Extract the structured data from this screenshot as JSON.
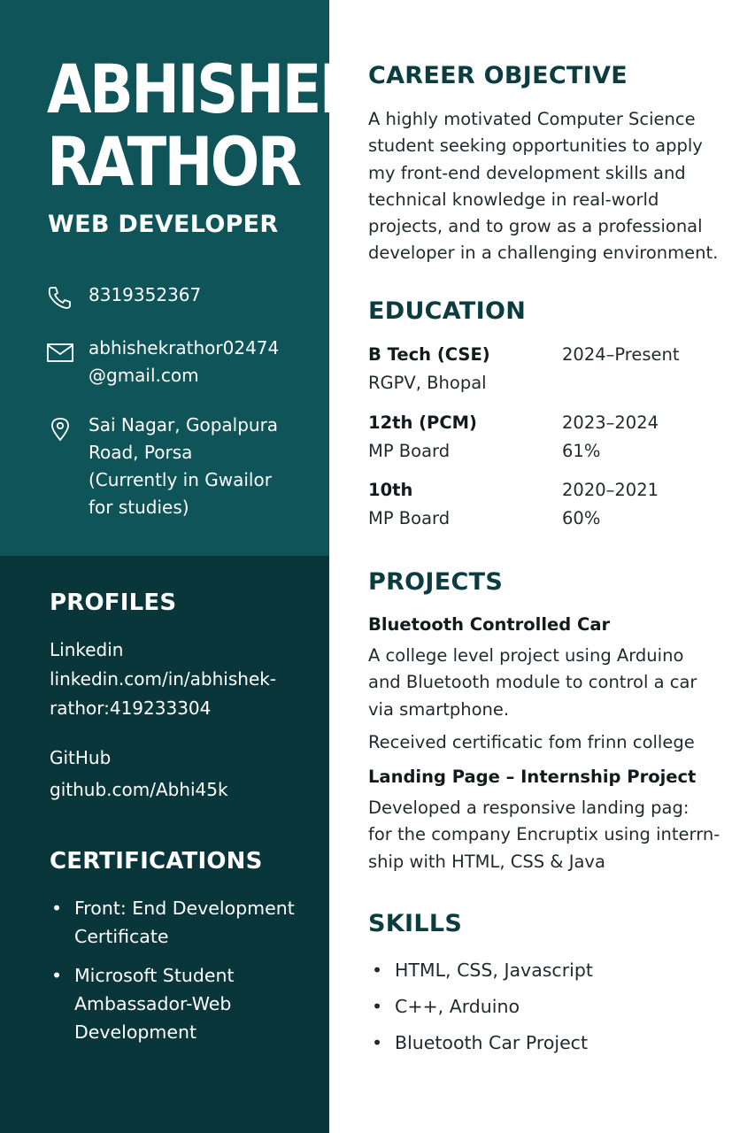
{
  "header": {
    "name_line1": "ABHISHEK",
    "name_line2": "RATHOR",
    "role": "WEB DEVELOPER"
  },
  "contact": {
    "phone": "8319352367",
    "email_line1": "abhishekrathor02474",
    "email_line2": "@gmail.com",
    "address_lines": [
      "Sai Nagar, Gopalpura",
      "Road, Porsa",
      "(Currently in Gwailor",
      "for studies)"
    ],
    "icons": [
      "phone-icon",
      "mail-icon",
      "location-pin-icon"
    ]
  },
  "profiles": {
    "heading": "PROFILES",
    "linkedin_label": "Linkedin",
    "linkedin_line1": "linkedin.com/in/abhishek-",
    "linkedin_line2": "rathor:419233304",
    "github_label": "GitHub",
    "github_url": "github.com/Abhi45k"
  },
  "certifications": {
    "heading": "CERTIFICATIONS",
    "items": [
      {
        "line1": "Front: End Development",
        "line2": "Certificate"
      },
      {
        "line1": "Microsoft Student",
        "line2": "Ambassador-Web",
        "line3": "Development"
      }
    ]
  },
  "objective": {
    "heading": "CAREER OBJECTIVE",
    "lines": [
      "A highly motivated Computer Science",
      "student seeking opportunities to apply",
      "my front-end development skills and",
      "technical knowledge in real-world",
      "projects, and to grow as a professional",
      "developer in a challenging environment."
    ]
  },
  "education": {
    "heading": "EDUCATION",
    "entries": [
      {
        "degree": "B Tech (CSE)",
        "institution": "RGPV, Bhopal",
        "years": "2024–Present",
        "score": ""
      },
      {
        "degree": "12th (PCM)",
        "institution": "MP Board",
        "years": "2023–2024",
        "score": "61%"
      },
      {
        "degree": "10th",
        "institution": "MP Board",
        "years": "2020–2021",
        "score": "60%"
      }
    ]
  },
  "projects": {
    "heading": "PROJECTS",
    "items": [
      {
        "title": "Bluetooth Controlled Car",
        "lines": [
          "A college level project using Arduino",
          "and Bluetooth module to control a car",
          "via smartphone."
        ],
        "note": "Received certificatic fom frinn college"
      },
      {
        "title": "Landing Page – Internship Project",
        "lines": [
          "Developed a responsive landing pag:",
          "for the company Encruptix using interrn-",
          "ship with HTML, CSS & Java"
        ]
      }
    ]
  },
  "skills": {
    "heading": "SKILLS",
    "items": [
      "HTML, CSS, Javascript",
      "C++, Arduino",
      "Bluetooth Car  Project"
    ]
  },
  "colors": {
    "sidebar_top": "#0e5458",
    "sidebar_bottom": "#08363b",
    "heading_text": "#0b3c40",
    "body_text": "#1f2a2c"
  }
}
